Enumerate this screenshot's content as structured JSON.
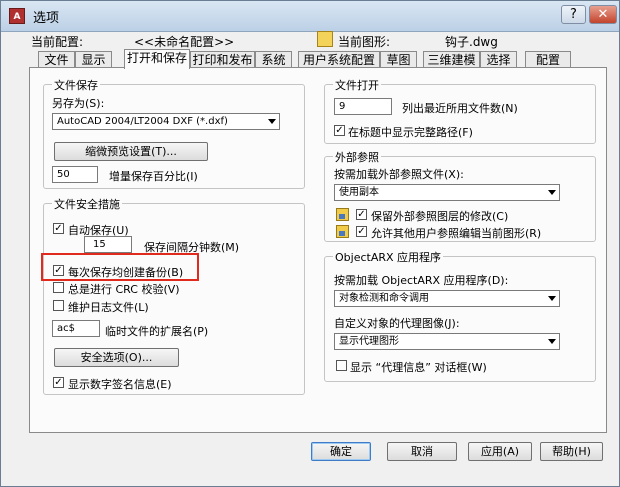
{
  "window": {
    "title": "选项"
  },
  "header": {
    "current_profile_label": "当前配置:",
    "current_profile_value": "<<未命名配置>>",
    "current_drawing_label": "当前图形:",
    "current_drawing_value": "钩子.dwg"
  },
  "tabs": [
    "文件",
    "显示",
    "打开和保存",
    "打印和发布",
    "系统",
    "用户系统配置",
    "草图",
    "三维建模",
    "选择",
    "配置"
  ],
  "active_tab": "打开和保存",
  "file_save": {
    "title": "文件保存",
    "save_as_label": "另存为(S):",
    "save_as_value": "AutoCAD 2004/LT2004 DXF (*.dxf)",
    "thumbnail_button": "缩微预览设置(T)...",
    "incremental_value": "50",
    "incremental_label": "增量保存百分比(I)"
  },
  "file_safety": {
    "title": "文件安全措施",
    "autosave_label": "自动保存(U)",
    "autosave_checked": true,
    "interval_value": "15",
    "interval_label": "保存间隔分钟数(M)",
    "backup_label": "每次保存均创建备份(B)",
    "backup_checked": true,
    "crc_label": "总是进行 CRC 校验(V)",
    "crc_checked": false,
    "log_label": "维护日志文件(L)",
    "log_checked": false,
    "temp_ext_value": "ac$",
    "temp_ext_label": "临时文件的扩展名(P)",
    "security_button": "安全选项(O)...",
    "digital_sig_label": "显示数字签名信息(E)",
    "digital_sig_checked": true
  },
  "file_open": {
    "title": "文件打开",
    "recent_value": "9",
    "recent_label": "列出最近所用文件数(N)",
    "full_path_label": "在标题中显示完整路径(F)",
    "full_path_checked": true
  },
  "xref": {
    "title": "外部参照",
    "demand_load_label": "按需加载外部参照文件(X):",
    "demand_load_value": "使用副本",
    "retain_label": "保留外部参照图层的修改(C)",
    "retain_checked": true,
    "allow_edit_label": "允许其他用户参照编辑当前图形(R)",
    "allow_edit_checked": true
  },
  "objectarx": {
    "title": "ObjectARX 应用程序",
    "demand_load_label": "按需加载 ObjectARX 应用程序(D):",
    "demand_load_value": "对象检测和命令调用",
    "proxy_label": "自定义对象的代理图像(J):",
    "proxy_value": "显示代理图形",
    "proxy_info_label": "显示 “代理信息” 对话框(W)",
    "proxy_info_checked": false
  },
  "buttons": {
    "ok": "确定",
    "cancel": "取消",
    "apply": "应用(A)",
    "help": "帮助(H)"
  },
  "colors": {
    "highlight": "#e02a1d",
    "titlebar": "#c7d8ec"
  }
}
